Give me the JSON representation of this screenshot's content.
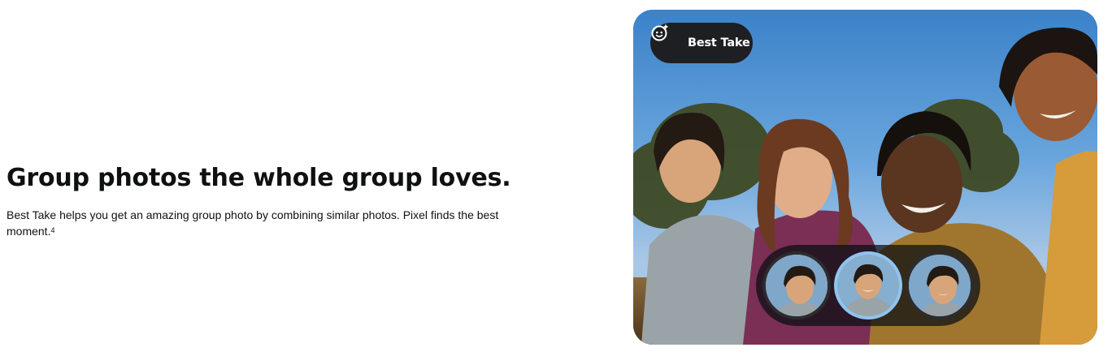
{
  "section": {
    "headline": "Group photos the whole group loves.",
    "body_text": "Best Take helps you get an amazing group photo by combining similar photos. Pixel finds the best moment.",
    "footnote": "4"
  },
  "photo": {
    "badge": {
      "label": "Best Take",
      "icon": "sparkle-face-icon"
    },
    "takes": [
      {
        "name": "take-1",
        "selected": false
      },
      {
        "name": "take-2",
        "selected": true
      },
      {
        "name": "take-3",
        "selected": false
      }
    ]
  }
}
